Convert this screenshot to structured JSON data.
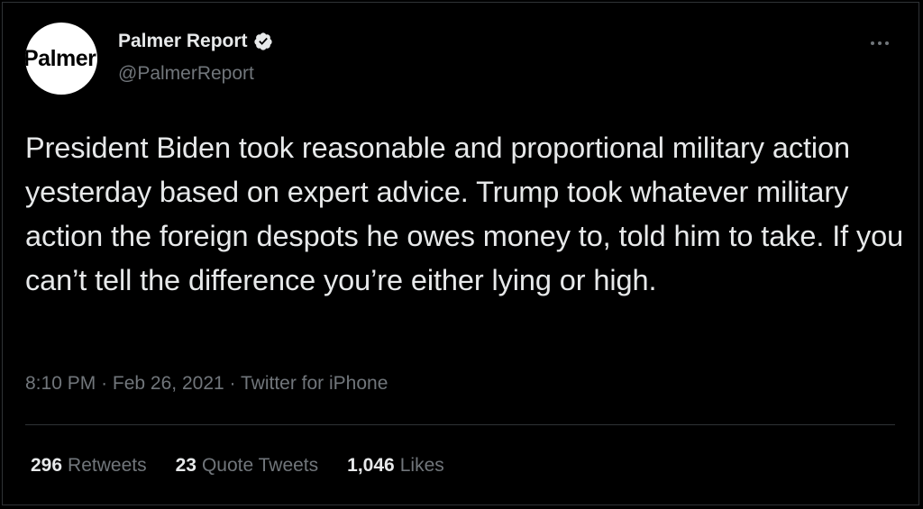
{
  "author": {
    "avatar_text": "Palmer",
    "display_name": "Palmer Report",
    "verified_icon": "verified-badge-icon",
    "handle": "@PalmerReport"
  },
  "tweet": {
    "text": "President Biden took reasonable and proportional military action yesterday based on expert advice. Trump took whatever military action the foreign despots he owes money to, told him to take. If you can’t tell the difference you’re either lying or high.",
    "time": "8:10 PM",
    "date": "Feb 26, 2021",
    "source": "Twitter for iPhone",
    "separator": "·"
  },
  "stats": {
    "retweets_count": "296",
    "retweets_label": "Retweets",
    "quotes_count": "23",
    "quotes_label": "Quote Tweets",
    "likes_count": "1,046",
    "likes_label": "Likes"
  },
  "colors": {
    "background": "#000000",
    "text_primary": "#e7e9ea",
    "text_secondary": "#71767b",
    "divider": "#2f3336",
    "verified_badge": "#e7e9ea"
  },
  "icons": {
    "more": "more-horizontal-icon"
  }
}
